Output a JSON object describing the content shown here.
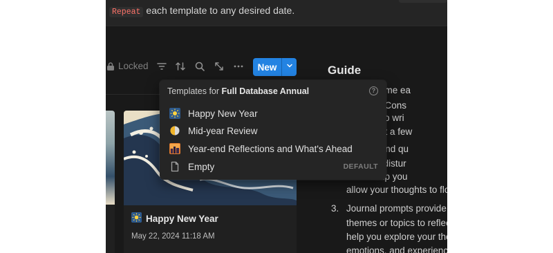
{
  "callout": {
    "chip_label": "Repeat",
    "text": "each template to any desired date."
  },
  "toolbar": {
    "locked_label": "Locked",
    "new_label": "New",
    "icons": [
      "lock-icon",
      "filter-icon",
      "sort-icon",
      "search-icon",
      "expand-icon",
      "more-icon",
      "chevron-down-icon"
    ]
  },
  "guide": {
    "title": "Guide",
    "lines": [
      "specific time ea",
      "urnaling. Cons",
      "n't need to wri",
      "or at least a few",
      "fortable and qu",
      "won't be distur",
      "nt will help you",
      "allow your thoughts to flo"
    ],
    "item3_number": "3.",
    "item3_lines": [
      "Journal prompts provide s",
      "themes or topics to reflec",
      "help you explore your tho",
      "emotions, and experience"
    ]
  },
  "templates_menu": {
    "heading_prefix": "Templates for",
    "heading_db": "Full Database Annual",
    "items": [
      {
        "label": "Happy New Year",
        "icon": "sunrise-icon",
        "badge": ""
      },
      {
        "label": "Mid-year Review",
        "icon": "half-circle-icon",
        "badge": ""
      },
      {
        "label": "Year-end Reflections and What's Ahead",
        "icon": "city-sunset-icon",
        "badge": ""
      },
      {
        "label": "Empty",
        "icon": "page-icon",
        "badge": "DEFAULT"
      }
    ]
  },
  "card": {
    "title": "Happy New Year",
    "date": "May 22, 2024 11:18 AM",
    "icon": "sunrise-icon"
  },
  "colors": {
    "accent": "#2383e2",
    "background": "#191919",
    "menu": "#252525",
    "code_red": "#ff7369"
  }
}
